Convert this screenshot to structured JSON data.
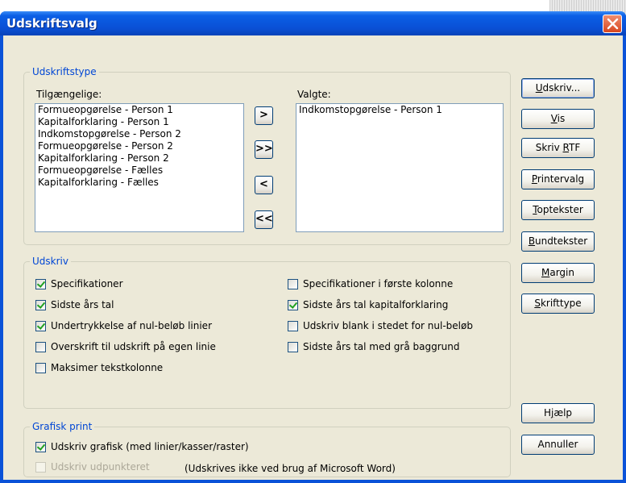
{
  "window": {
    "title": "Udskriftsvalg"
  },
  "udskriftstype": {
    "legend": "Udskriftstype",
    "available_label": "Tilgængelige:",
    "available_items": [
      "Formueopgørelse - Person 1",
      "Kapitalforklaring - Person 1",
      "Indkomstopgørelse - Person 2",
      "Formueopgørelse - Person 2",
      "Kapitalforklaring - Person 2",
      "Formueopgørelse - Fælles",
      "Kapitalforklaring - Fælles"
    ],
    "selected_label": "Valgte:",
    "selected_items": [
      "Indkomstopgørelse - Person 1"
    ],
    "move_buttons": {
      "add": ">",
      "add_all": ">>",
      "remove": "<",
      "remove_all": "<<"
    }
  },
  "udskriv": {
    "legend": "Udskriv",
    "left": [
      {
        "label": "Specifikationer",
        "checked": true
      },
      {
        "label": "Sidste års tal",
        "checked": true
      },
      {
        "label": "Undertrykkelse af nul-beløb linier",
        "checked": true
      },
      {
        "label": "Overskrift til udskrift på egen linie",
        "checked": false
      },
      {
        "label": "Maksimer tekstkolonne",
        "checked": false
      }
    ],
    "right": [
      {
        "label": "Specifikationer i første kolonne",
        "checked": false
      },
      {
        "label": "Sidste års tal kapitalforklaring",
        "checked": true
      },
      {
        "label": "Udskriv blank i stedet for nul-beløb",
        "checked": false
      },
      {
        "label": "Sidste års tal med grå baggrund",
        "checked": false
      }
    ]
  },
  "grafisk": {
    "legend": "Grafisk print",
    "options": [
      {
        "label": "Udskriv grafisk (med linier/kasser/raster)",
        "checked": true,
        "enabled": true
      },
      {
        "label": "Udskriv udpunkteret",
        "checked": false,
        "enabled": false
      }
    ],
    "note": "(Udskrives ikke ved brug af Microsoft Word)"
  },
  "buttons": {
    "udskriv": {
      "before": "",
      "mn": "U",
      "after": "dskriv..."
    },
    "vis": {
      "before": "",
      "mn": "V",
      "after": "is"
    },
    "skriv_rtf": {
      "before": "Skriv ",
      "mn": "R",
      "after": "TF"
    },
    "printervalg": {
      "before": "",
      "mn": "P",
      "after": "rintervalg"
    },
    "toptekster": {
      "before": "",
      "mn": "T",
      "after": "optekster"
    },
    "bundtekster": {
      "before": "",
      "mn": "B",
      "after": "undtekster"
    },
    "margin": {
      "before": "",
      "mn": "M",
      "after": "argin"
    },
    "skrifttype": {
      "before": "",
      "mn": "S",
      "after": "krifttype"
    },
    "hjaelp": {
      "before": "H",
      "mn": "j",
      "after": "ælp"
    },
    "annuller": {
      "before": "Annuller",
      "mn": "",
      "after": ""
    }
  },
  "colors": {
    "titlebar": "#0a50d6",
    "group_title": "#0046d5",
    "face": "#ece9d8"
  }
}
